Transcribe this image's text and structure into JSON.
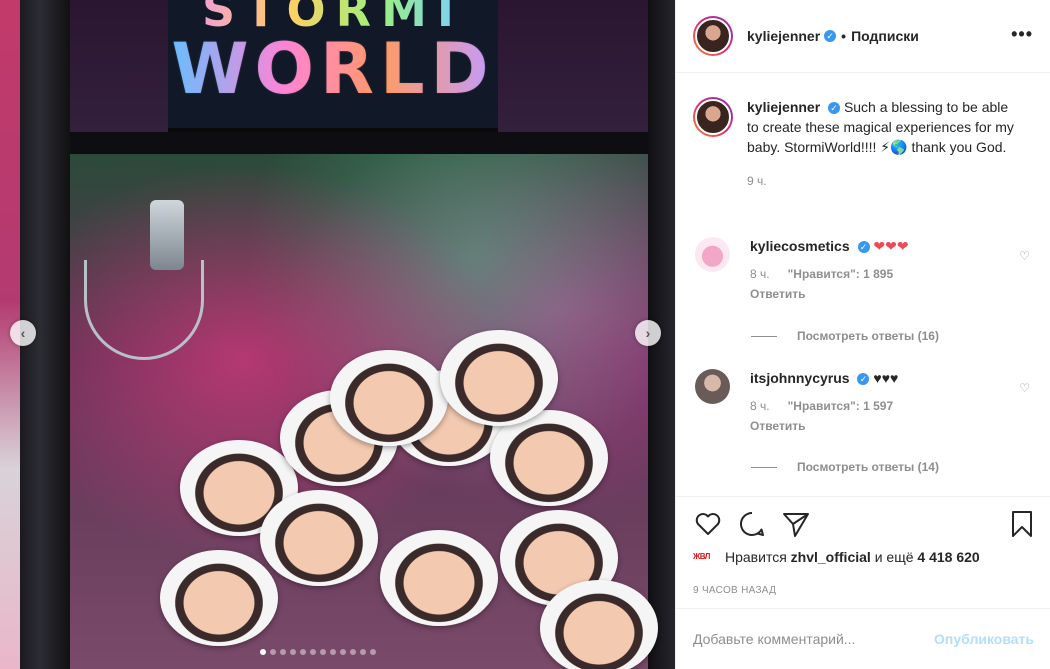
{
  "media": {
    "sign_line1": "STORMI",
    "sign_line2": "WORLD",
    "carousel_dots": 12,
    "active_dot": 0,
    "prev_icon": "chevron-left-icon",
    "next_icon": "chevron-right-icon"
  },
  "header": {
    "username": "kyliejenner",
    "separator": "•",
    "follow_label": "Подписки",
    "more_icon": "•••"
  },
  "caption": {
    "username": "kyliejenner",
    "text": "Such a blessing to be able to create these magical experiences for my baby. StormiWorld!!!! ⚡🌎 thank you God.",
    "time": "9 ч."
  },
  "comments": [
    {
      "username": "kyliecosmetics",
      "text": "❤❤❤",
      "time": "8 ч.",
      "likes": "\"Нравится\": 1 895",
      "reply": "Ответить",
      "view_replies": "Посмотреть ответы (16)"
    },
    {
      "username": "itsjohnnycyrus",
      "text": "♥♥♥",
      "time": "8 ч.",
      "likes": "\"Нравится\": 1 597",
      "reply": "Ответить",
      "view_replies": "Посмотреть ответы (14)"
    }
  ],
  "actions": {
    "liked_by_prefix": "Нравится",
    "liked_by_user": "zhvl_official",
    "liked_by_and": "и ещё",
    "liked_by_count": "4 418 620",
    "liker_logo": "ЖВЛ",
    "post_time": "9 ЧАСОВ НАЗАД"
  },
  "add_comment": {
    "placeholder": "Добавьте комментарий...",
    "publish_label": "Опубликовать"
  },
  "colors": {
    "verified": "#3897f0",
    "publish_disabled": "#b2dffc",
    "muted": "#8e8e8e",
    "heart_red": "#ed4956"
  }
}
